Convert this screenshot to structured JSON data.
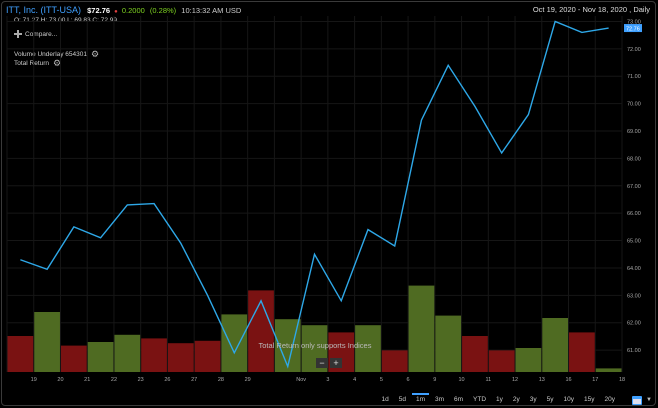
{
  "header": {
    "name": "ITT, Inc. (ITT-USA)",
    "price": "$72.76",
    "change": "0.2000",
    "pct": "(0.28%)",
    "time": "10:13:32 AM USD",
    "range": "Oct 19, 2020 - Nov 18, 2020 , Daily"
  },
  "ohlc": "O: 71.27 H: 73.00 L: 69.83 C: 72.99",
  "compare_label": "Compare...",
  "studies": [
    {
      "label": "Volume Underlay  654301"
    },
    {
      "label": "Total Return"
    }
  ],
  "notice": "Total Return only supports Indices",
  "zoom": {
    "minus": "−",
    "plus": "+"
  },
  "periods": [
    {
      "label": "1d"
    },
    {
      "label": "5d"
    },
    {
      "label": "1m",
      "active": true
    },
    {
      "label": "3m"
    },
    {
      "label": "6m"
    },
    {
      "label": "YTD"
    },
    {
      "label": "1y"
    },
    {
      "label": "2y"
    },
    {
      "label": "3y"
    },
    {
      "label": "5y"
    },
    {
      "label": "10y"
    },
    {
      "label": "15y"
    },
    {
      "label": "20y"
    }
  ],
  "last_price_tag": "72.76",
  "colors": {
    "line": "#2ea8e8",
    "vol_up": "#4f6b22",
    "vol_down": "#7a1212",
    "accent": "#3fa0ff"
  },
  "chart_data": {
    "type": "line",
    "ylim": [
      60.2,
      73.2
    ],
    "y_ticks": [
      "61.00",
      "62.00",
      "63.00",
      "64.00",
      "65.00",
      "66.00",
      "67.00",
      "68.00",
      "69.00",
      "70.00",
      "71.00",
      "72.00",
      "73.00"
    ],
    "categories": [
      "",
      "19",
      "20",
      "21",
      "22",
      "23",
      "26",
      "27",
      "28",
      "29",
      "30",
      "Nov",
      "3",
      "4",
      "5",
      "6",
      "9",
      "10",
      "11",
      "12",
      "13",
      "16",
      "17",
      "18"
    ],
    "x_labels": [
      "19",
      "20",
      "21",
      "22",
      "23",
      "26",
      "27",
      "28",
      "29",
      "Nov",
      "3",
      "4",
      "5",
      "6",
      "9",
      "10",
      "11",
      "12",
      "13",
      "16",
      "17",
      "18"
    ],
    "series": [
      {
        "values": [
          64.3,
          63.95,
          65.5,
          65.1,
          66.3,
          66.35,
          64.9,
          63.0,
          60.9,
          62.8,
          60.4,
          64.5,
          62.8,
          65.4,
          64.8,
          69.4,
          71.4,
          69.9,
          68.2,
          69.6,
          73.0,
          72.6,
          72.76
        ]
      }
    ],
    "volume": [
      {
        "v": 0.3,
        "up": false
      },
      {
        "v": 0.5,
        "up": true
      },
      {
        "v": 0.22,
        "up": false
      },
      {
        "v": 0.25,
        "up": true
      },
      {
        "v": 0.31,
        "up": true
      },
      {
        "v": 0.28,
        "up": false
      },
      {
        "v": 0.24,
        "up": false
      },
      {
        "v": 0.26,
        "up": false
      },
      {
        "v": 0.48,
        "up": true
      },
      {
        "v": 0.68,
        "up": false
      },
      {
        "v": 0.44,
        "up": true
      },
      {
        "v": 0.39,
        "up": true
      },
      {
        "v": 0.33,
        "up": false
      },
      {
        "v": 0.39,
        "up": true
      },
      {
        "v": 0.18,
        "up": false
      },
      {
        "v": 0.72,
        "up": true
      },
      {
        "v": 0.47,
        "up": true
      },
      {
        "v": 0.3,
        "up": false
      },
      {
        "v": 0.18,
        "up": false
      },
      {
        "v": 0.2,
        "up": true
      },
      {
        "v": 0.45,
        "up": true
      },
      {
        "v": 0.33,
        "up": false
      },
      {
        "v": 0.03,
        "up": true
      }
    ]
  }
}
